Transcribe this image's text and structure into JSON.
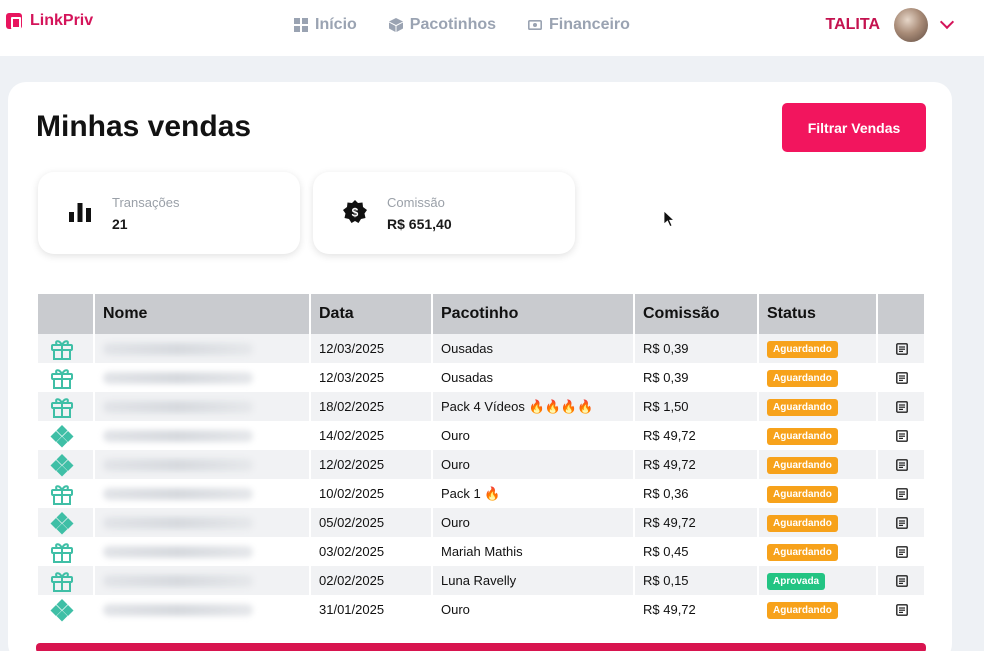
{
  "brand": {
    "name": "LinkPriv",
    "color": "#e8155e"
  },
  "nav": [
    {
      "label": "Início",
      "icon": "grid-icon"
    },
    {
      "label": "Pacotinhos",
      "icon": "box-icon"
    },
    {
      "label": "Financeiro",
      "icon": "cash-icon"
    }
  ],
  "user": {
    "name": "TALITA"
  },
  "page": {
    "title": "Minhas vendas",
    "filter_label": "Filtrar Vendas"
  },
  "stats": [
    {
      "label": "Transações",
      "value": "21",
      "icon": "bar-chart-icon"
    },
    {
      "label": "Comissão",
      "value": "R$ 651,40",
      "icon": "dollar-badge-icon"
    }
  ],
  "table": {
    "headers": [
      "",
      "Nome",
      "Data",
      "Pacotinho",
      "Comissão",
      "Status",
      ""
    ],
    "rows": [
      {
        "type": "gift",
        "date": "12/03/2025",
        "package": "Ousadas",
        "commission": "R$ 0,39",
        "status": "Aguardando"
      },
      {
        "type": "gift",
        "date": "12/03/2025",
        "package": "Ousadas",
        "commission": "R$ 0,39",
        "status": "Aguardando"
      },
      {
        "type": "gift",
        "date": "18/02/2025",
        "package": "Pack 4 Vídeos 🔥🔥🔥🔥",
        "commission": "R$ 1,50",
        "status": "Aguardando"
      },
      {
        "type": "diamond",
        "date": "14/02/2025",
        "package": "Ouro",
        "commission": "R$ 49,72",
        "status": "Aguardando"
      },
      {
        "type": "diamond",
        "date": "12/02/2025",
        "package": "Ouro",
        "commission": "R$ 49,72",
        "status": "Aguardando"
      },
      {
        "type": "gift",
        "date": "10/02/2025",
        "package": "Pack 1 🔥",
        "commission": "R$ 0,36",
        "status": "Aguardando"
      },
      {
        "type": "diamond",
        "date": "05/02/2025",
        "package": "Ouro",
        "commission": "R$ 49,72",
        "status": "Aguardando"
      },
      {
        "type": "gift",
        "date": "03/02/2025",
        "package": "Mariah Mathis",
        "commission": "R$ 0,45",
        "status": "Aguardando"
      },
      {
        "type": "gift",
        "date": "02/02/2025",
        "package": "Luna Ravelly",
        "commission": "R$ 0,15",
        "status": "Aprovada"
      },
      {
        "type": "diamond",
        "date": "31/01/2025",
        "package": "Ouro",
        "commission": "R$ 49,72",
        "status": "Aguardando"
      }
    ]
  },
  "colors": {
    "accent": "#f2155e",
    "waiting": "#f7a21b",
    "approved": "#23c483",
    "icon_teal": "#3fbfa6"
  }
}
